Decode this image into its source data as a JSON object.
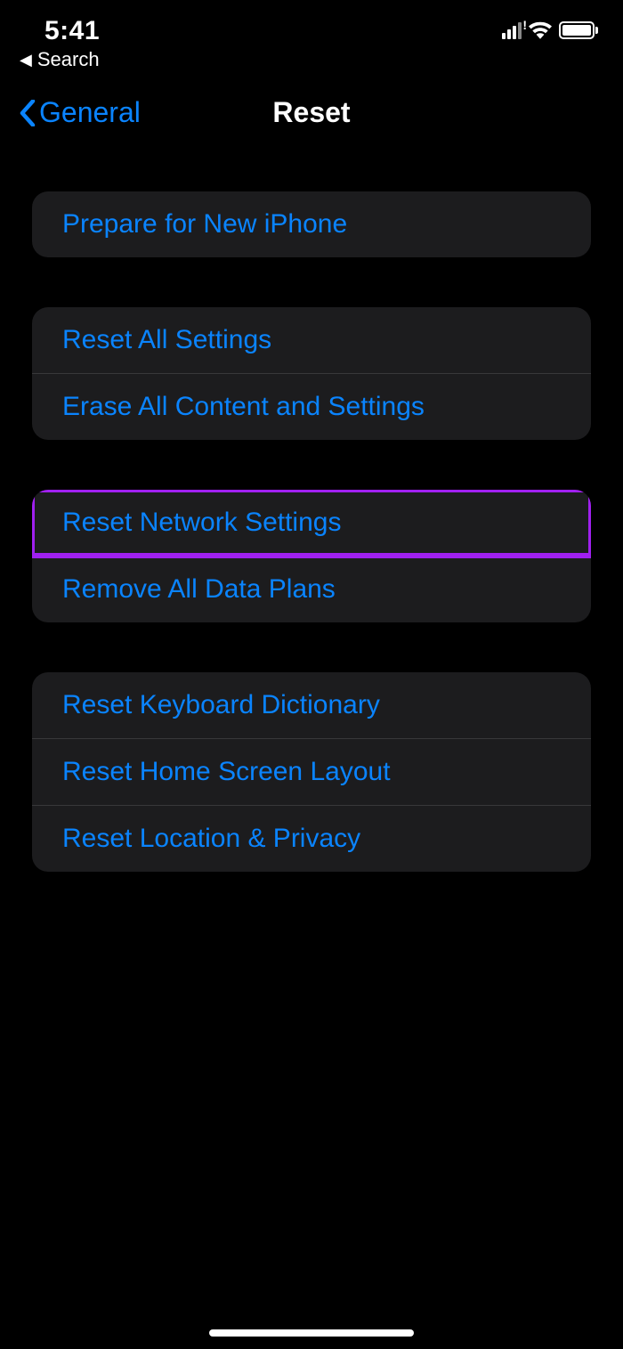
{
  "status": {
    "time": "5:41"
  },
  "breadcrumb": {
    "label": "Search"
  },
  "nav": {
    "back_label": "General",
    "title": "Reset"
  },
  "groups": [
    {
      "rows": [
        {
          "label": "Prepare for New iPhone",
          "highlight": false
        }
      ]
    },
    {
      "rows": [
        {
          "label": "Reset All Settings",
          "highlight": false
        },
        {
          "label": "Erase All Content and Settings",
          "highlight": false
        }
      ]
    },
    {
      "rows": [
        {
          "label": "Reset Network Settings",
          "highlight": true
        },
        {
          "label": "Remove All Data Plans",
          "highlight": false
        }
      ]
    },
    {
      "rows": [
        {
          "label": "Reset Keyboard Dictionary",
          "highlight": false
        },
        {
          "label": "Reset Home Screen Layout",
          "highlight": false
        },
        {
          "label": "Reset Location & Privacy",
          "highlight": false
        }
      ]
    }
  ]
}
